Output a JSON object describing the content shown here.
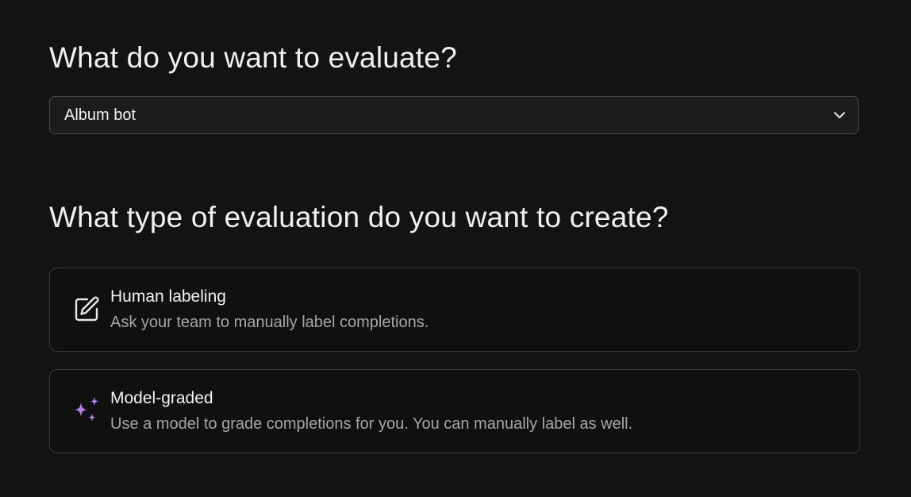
{
  "section_evaluate": {
    "heading": "What do you want to evaluate?",
    "select": {
      "value": "Album bot",
      "icon": "chevron-down-icon"
    }
  },
  "section_type": {
    "heading": "What type of evaluation do you want to create?",
    "options": [
      {
        "title": "Human labeling",
        "description": "Ask your team to manually label completions.",
        "icon": "edit-pencil-icon",
        "icon_color": "#e8e8e8"
      },
      {
        "title": "Model-graded",
        "description": "Use a model to grade completions for you. You can manually label as well.",
        "icon": "sparkles-icon",
        "icon_color": "#b57cf0"
      }
    ]
  }
}
